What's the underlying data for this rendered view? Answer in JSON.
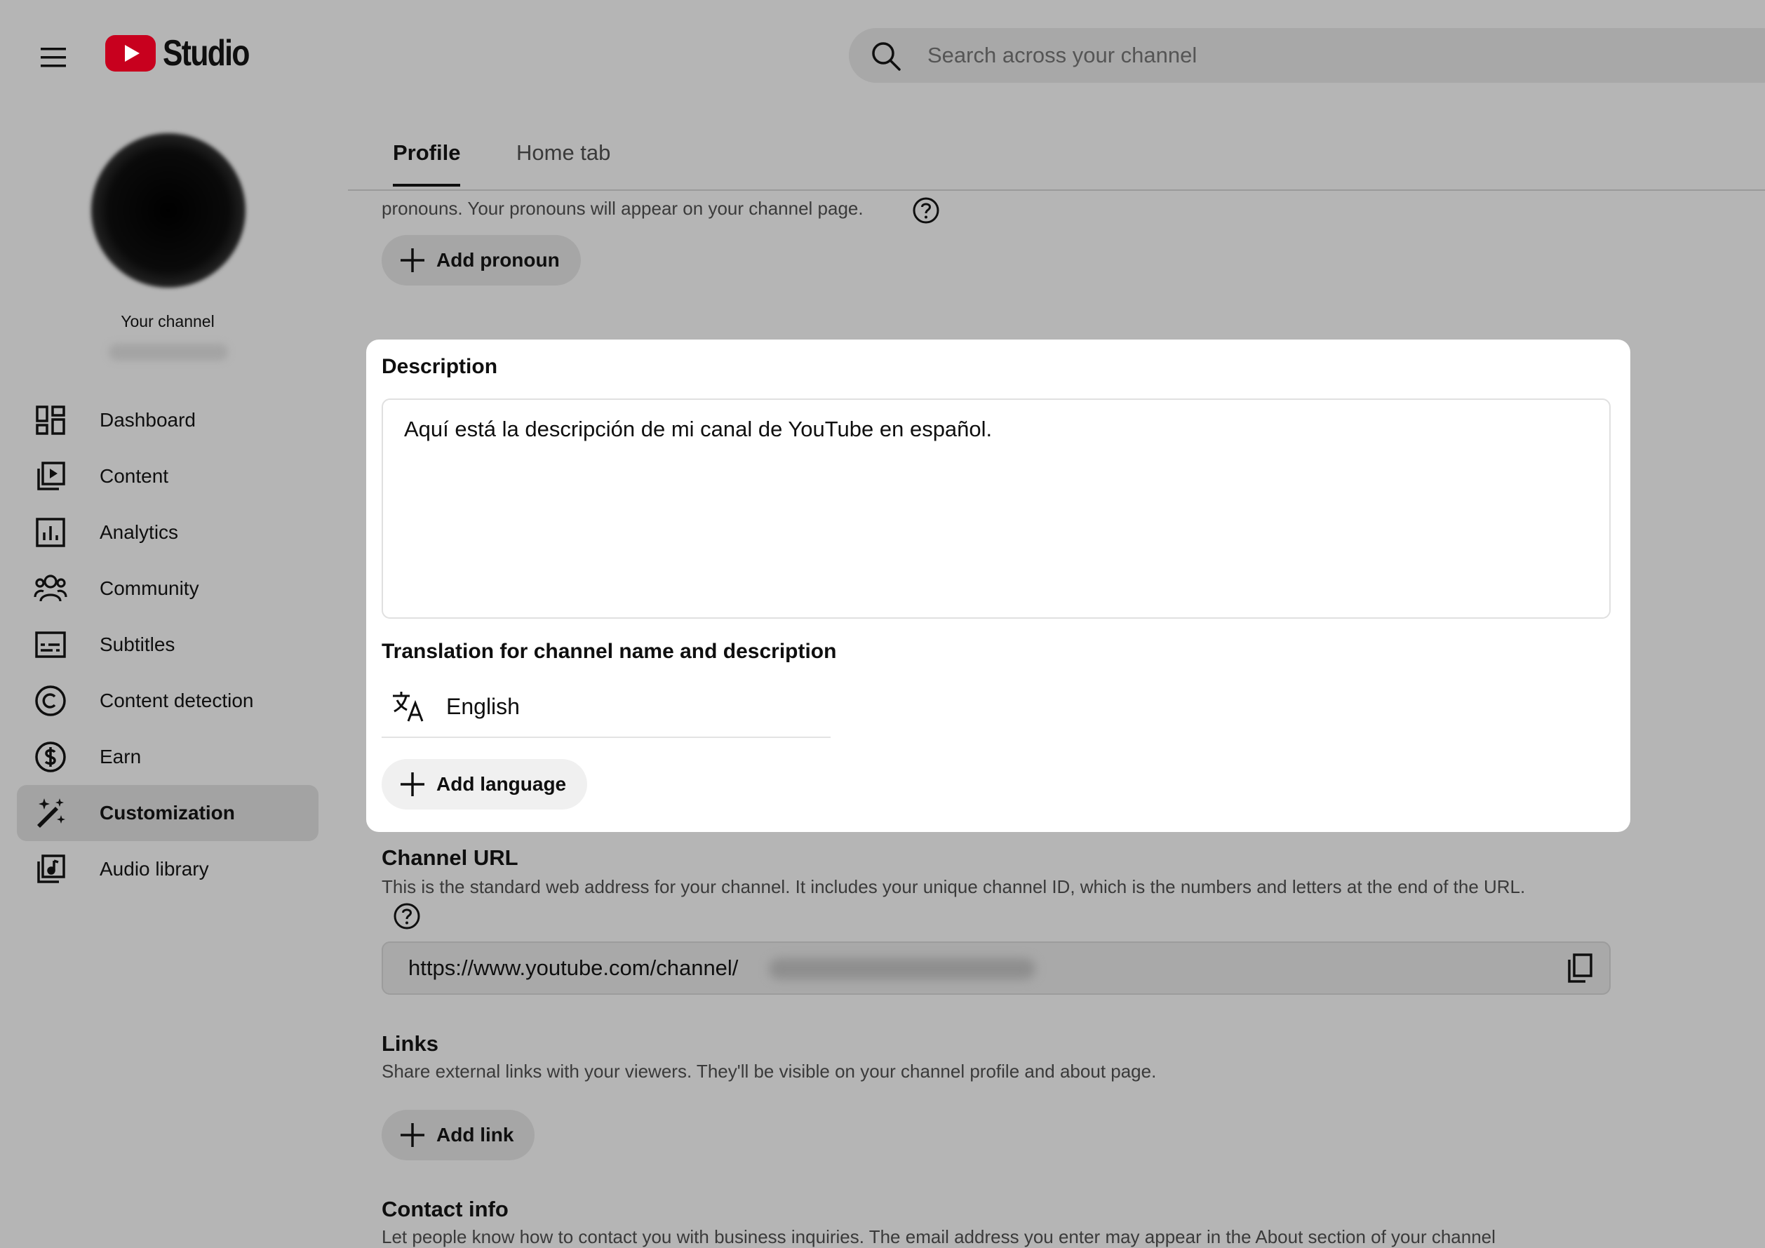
{
  "header": {
    "logo_text": "Studio",
    "search_placeholder": "Search across your channel"
  },
  "sidebar": {
    "channel_label": "Your channel",
    "items": [
      {
        "label": "Dashboard",
        "icon": "dashboard-icon"
      },
      {
        "label": "Content",
        "icon": "content-icon"
      },
      {
        "label": "Analytics",
        "icon": "analytics-icon"
      },
      {
        "label": "Community",
        "icon": "community-icon"
      },
      {
        "label": "Subtitles",
        "icon": "subtitles-icon"
      },
      {
        "label": "Content detection",
        "icon": "copyright-icon"
      },
      {
        "label": "Earn",
        "icon": "dollar-icon"
      },
      {
        "label": "Customization",
        "icon": "magic-wand-icon",
        "active": true
      },
      {
        "label": "Audio library",
        "icon": "audio-library-icon"
      }
    ]
  },
  "tabs": [
    {
      "label": "Profile",
      "active": true
    },
    {
      "label": "Home tab",
      "active": false
    }
  ],
  "pronouns": {
    "text_partial": "pronouns. Your pronouns will appear on your channel page.",
    "add_label": "Add pronoun"
  },
  "description": {
    "title": "Description",
    "value": "Aquí está la descripción de mi canal de YouTube en español.",
    "translation_title": "Translation for channel name and description",
    "translation_language": "English",
    "add_language_label": "Add language"
  },
  "channel_url": {
    "title": "Channel URL",
    "description": "This is the standard web address for your channel. It includes your unique channel ID, which is the numbers and letters at the end of the URL.",
    "url_prefix": "https://www.youtube.com/channel/"
  },
  "links": {
    "title": "Links",
    "description": "Share external links with your viewers. They'll be visible on your channel profile and about page.",
    "add_label": "Add link"
  },
  "contact": {
    "title": "Contact info",
    "description_partial": "Let people know how to contact you with business inquiries. The email address you enter may appear in the About section of your channel"
  },
  "colors": {
    "brand_red": "#ff0000",
    "card_bg": "#ffffff",
    "dim_overlay": "#b5b5b5"
  }
}
